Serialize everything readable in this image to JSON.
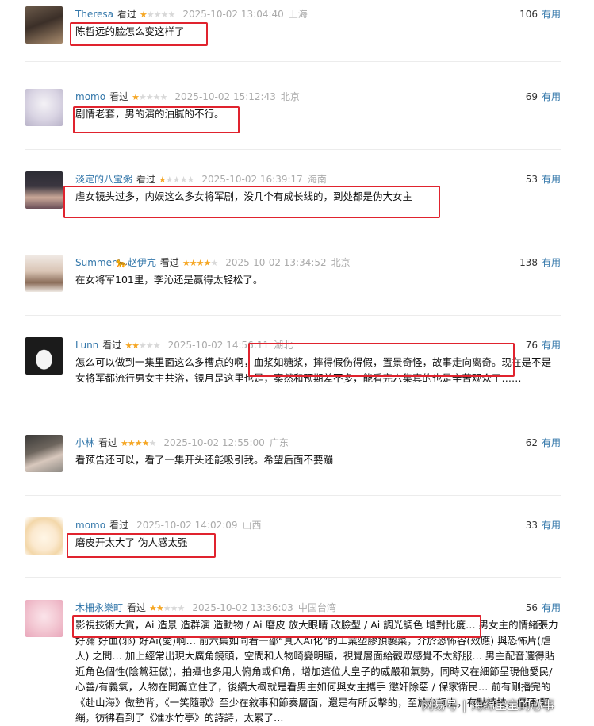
{
  "labels": {
    "watched": "看过",
    "useful": "有用"
  },
  "reviews": [
    {
      "user": "Theresa",
      "stars_filled": 1,
      "rating": 1,
      "time": "2025-10-02 13:04:40",
      "location": "上海",
      "votes": "106",
      "text": "陈哲远的脸怎么变这样了"
    },
    {
      "user": "momo",
      "stars_filled": 1,
      "rating": 1,
      "time": "2025-10-02 15:12:43",
      "location": "北京",
      "votes": "69",
      "text": "剧情老套，男的演的油腻的不行。"
    },
    {
      "user": "淡定的八宝粥",
      "stars_filled": 1,
      "rating": 1,
      "time": "2025-10-02 16:39:17",
      "location": "海南",
      "votes": "53",
      "text": "虐女镜头过多，内娱这么多女将军剧，没几个有成长线的，到处都是伪大女主"
    },
    {
      "user": "Summer🐆赵伊亢",
      "stars_filled": 4,
      "rating": 4,
      "time": "2025-10-02 13:34:52",
      "location": "北京",
      "votes": "138",
      "text": "在女将军101里，李沁还是赢得太轻松了。"
    },
    {
      "user": "Lunn",
      "stars_filled": 2,
      "rating": 2,
      "time": "2025-10-02 14:56:11",
      "location": "湖北",
      "votes": "76",
      "text": "怎么可以做到一集里面这么多槽点的啊，血浆如糖浆，摔得假伤得假，置景奇怪，故事走向离奇。现在是不是女将军都流行男女主共浴，镜月是这里也是，案然和预期差不多，能看完六集真的也是辛苦观众了……"
    },
    {
      "user": "小林",
      "stars_filled": 4,
      "rating": 4,
      "time": "2025-10-02 12:55:00",
      "location": "广东",
      "votes": "62",
      "text": "看预告还可以，看了一集开头还能吸引我。希望后面不要蹦"
    },
    {
      "user": "momo",
      "stars_filled": 0,
      "rating": 0,
      "time": "2025-10-02 14:02:09",
      "location": "山西",
      "votes": "33",
      "text": "磨皮开太大了 伪人感太强"
    },
    {
      "user": "木柵永樂町",
      "stars_filled": 2,
      "rating": 2,
      "time": "2025-10-02 13:36:03",
      "location": "中国台湾",
      "votes": "56",
      "text": "影視技術大賞，Ai 造景 造群演 造動物 / Ai 磨皮 放大眼睛 改臉型 / Ai 調光調色 增對比度… 男女主的情緒張力好瀰 好血(邪) 好Ai(愛)啊… 前六集如同看一部“真人Ai化”的工業塑膠預製菜，介於恐怖谷(效應) 與恐怖片(虐人) 之間… 加上經常出現大廣角鏡頭，空間和人物畸變明顯，視覺層面給觀眾感覺不太舒服… 男主配音選得貼近角色個性(陰鷙狂傲)，拍攝也多用大俯角或仰角，增加這位大皇子的威嚴和氣勢，同時又在細節呈現他愛民/心善/有義氣，人物在開篇立住了，後續大概就是看男主如何與女主攜手 懲奸除惡 / 保家衛民… 前有剛播完的《赴山海》做墊背，《一笑隨歌》至少在敘事和節奏層面，還是有所反擊的，至於台詞上，有點詩技，僵硬/緊繃，彷彿看到了《准水竹亭》的詩詩，太累了…"
    }
  ],
  "watermark": {
    "platform": "网易号",
    "author": "海绵宝宝的心事"
  }
}
